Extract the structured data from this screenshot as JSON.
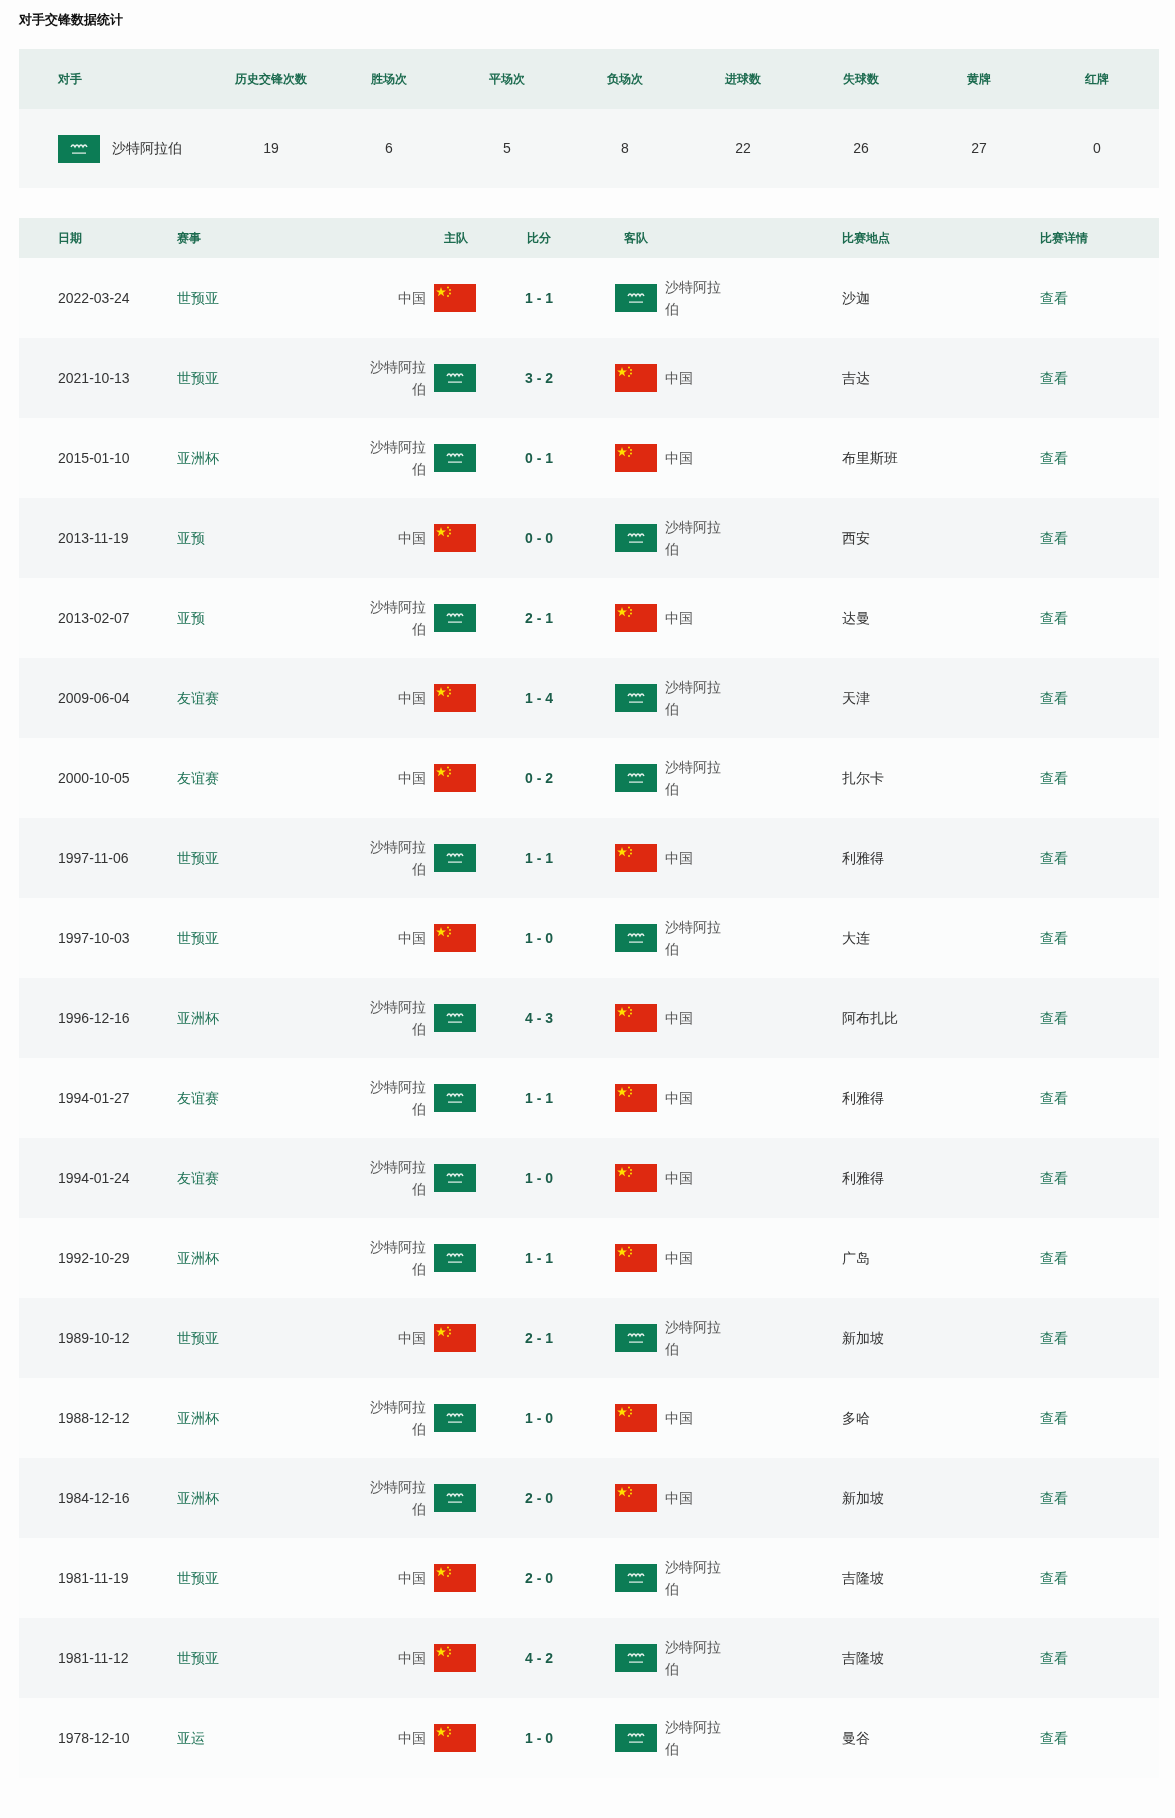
{
  "title": "对手交锋数据统计",
  "summary": {
    "columns": [
      "对手",
      "历史交锋次数",
      "胜场次",
      "平场次",
      "负场次",
      "进球数",
      "失球数",
      "黄牌",
      "红牌"
    ],
    "row": {
      "opponent": {
        "name": "沙特阿拉伯",
        "kind": "saudi"
      },
      "values": [
        "19",
        "6",
        "5",
        "8",
        "22",
        "26",
        "27",
        "0"
      ]
    }
  },
  "matches": {
    "columns": [
      "日期",
      "赛事",
      "主队",
      "比分",
      "客队",
      "比赛地点",
      "比赛详情"
    ],
    "rows": [
      {
        "date": "2022-03-24",
        "competition": "世预亚",
        "home": {
          "name": "中国",
          "kind": "china"
        },
        "score": "1 - 1",
        "away": {
          "name": "沙特阿拉伯",
          "kind": "saudi"
        },
        "venue": "沙迦",
        "details": "查看"
      },
      {
        "date": "2021-10-13",
        "competition": "世预亚",
        "home": {
          "name": "沙特阿拉伯",
          "kind": "saudi"
        },
        "score": "3 - 2",
        "away": {
          "name": "中国",
          "kind": "china"
        },
        "venue": "吉达",
        "details": "查看"
      },
      {
        "date": "2015-01-10",
        "competition": "亚洲杯",
        "home": {
          "name": "沙特阿拉伯",
          "kind": "saudi"
        },
        "score": "0 - 1",
        "away": {
          "name": "中国",
          "kind": "china"
        },
        "venue": "布里斯班",
        "details": "查看"
      },
      {
        "date": "2013-11-19",
        "competition": "亚预",
        "home": {
          "name": "中国",
          "kind": "china"
        },
        "score": "0 - 0",
        "away": {
          "name": "沙特阿拉伯",
          "kind": "saudi"
        },
        "venue": "西安",
        "details": "查看"
      },
      {
        "date": "2013-02-07",
        "competition": "亚预",
        "home": {
          "name": "沙特阿拉伯",
          "kind": "saudi"
        },
        "score": "2 - 1",
        "away": {
          "name": "中国",
          "kind": "china"
        },
        "venue": "达曼",
        "details": "查看"
      },
      {
        "date": "2009-06-04",
        "competition": "友谊赛",
        "home": {
          "name": "中国",
          "kind": "china"
        },
        "score": "1 - 4",
        "away": {
          "name": "沙特阿拉伯",
          "kind": "saudi"
        },
        "venue": "天津",
        "details": "查看"
      },
      {
        "date": "2000-10-05",
        "competition": "友谊赛",
        "home": {
          "name": "中国",
          "kind": "china"
        },
        "score": "0 - 2",
        "away": {
          "name": "沙特阿拉伯",
          "kind": "saudi"
        },
        "venue": "扎尔卡",
        "details": "查看"
      },
      {
        "date": "1997-11-06",
        "competition": "世预亚",
        "home": {
          "name": "沙特阿拉伯",
          "kind": "saudi"
        },
        "score": "1 - 1",
        "away": {
          "name": "中国",
          "kind": "china"
        },
        "venue": "利雅得",
        "details": "查看"
      },
      {
        "date": "1997-10-03",
        "competition": "世预亚",
        "home": {
          "name": "中国",
          "kind": "china"
        },
        "score": "1 - 0",
        "away": {
          "name": "沙特阿拉伯",
          "kind": "saudi"
        },
        "venue": "大连",
        "details": "查看"
      },
      {
        "date": "1996-12-16",
        "competition": "亚洲杯",
        "home": {
          "name": "沙特阿拉伯",
          "kind": "saudi"
        },
        "score": "4 - 3",
        "away": {
          "name": "中国",
          "kind": "china"
        },
        "venue": "阿布扎比",
        "details": "查看"
      },
      {
        "date": "1994-01-27",
        "competition": "友谊赛",
        "home": {
          "name": "沙特阿拉伯",
          "kind": "saudi"
        },
        "score": "1 - 1",
        "away": {
          "name": "中国",
          "kind": "china"
        },
        "venue": "利雅得",
        "details": "查看"
      },
      {
        "date": "1994-01-24",
        "competition": "友谊赛",
        "home": {
          "name": "沙特阿拉伯",
          "kind": "saudi"
        },
        "score": "1 - 0",
        "away": {
          "name": "中国",
          "kind": "china"
        },
        "venue": "利雅得",
        "details": "查看"
      },
      {
        "date": "1992-10-29",
        "competition": "亚洲杯",
        "home": {
          "name": "沙特阿拉伯",
          "kind": "saudi"
        },
        "score": "1 - 1",
        "away": {
          "name": "中国",
          "kind": "china"
        },
        "venue": "广岛",
        "details": "查看"
      },
      {
        "date": "1989-10-12",
        "competition": "世预亚",
        "home": {
          "name": "中国",
          "kind": "china"
        },
        "score": "2 - 1",
        "away": {
          "name": "沙特阿拉伯",
          "kind": "saudi"
        },
        "venue": "新加坡",
        "details": "查看"
      },
      {
        "date": "1988-12-12",
        "competition": "亚洲杯",
        "home": {
          "name": "沙特阿拉伯",
          "kind": "saudi"
        },
        "score": "1 - 0",
        "away": {
          "name": "中国",
          "kind": "china"
        },
        "venue": "多哈",
        "details": "查看"
      },
      {
        "date": "1984-12-16",
        "competition": "亚洲杯",
        "home": {
          "name": "沙特阿拉伯",
          "kind": "saudi"
        },
        "score": "2 - 0",
        "away": {
          "name": "中国",
          "kind": "china"
        },
        "venue": "新加坡",
        "details": "查看"
      },
      {
        "date": "1981-11-19",
        "competition": "世预亚",
        "home": {
          "name": "中国",
          "kind": "china"
        },
        "score": "2 - 0",
        "away": {
          "name": "沙特阿拉伯",
          "kind": "saudi"
        },
        "venue": "吉隆坡",
        "details": "查看"
      },
      {
        "date": "1981-11-12",
        "competition": "世预亚",
        "home": {
          "name": "中国",
          "kind": "china"
        },
        "score": "4 - 2",
        "away": {
          "name": "沙特阿拉伯",
          "kind": "saudi"
        },
        "venue": "吉隆坡",
        "details": "查看"
      },
      {
        "date": "1978-12-10",
        "competition": "亚运",
        "home": {
          "name": "中国",
          "kind": "china"
        },
        "score": "1 - 0",
        "away": {
          "name": "沙特阿拉伯",
          "kind": "saudi"
        },
        "venue": "曼谷",
        "details": "查看"
      }
    ]
  }
}
